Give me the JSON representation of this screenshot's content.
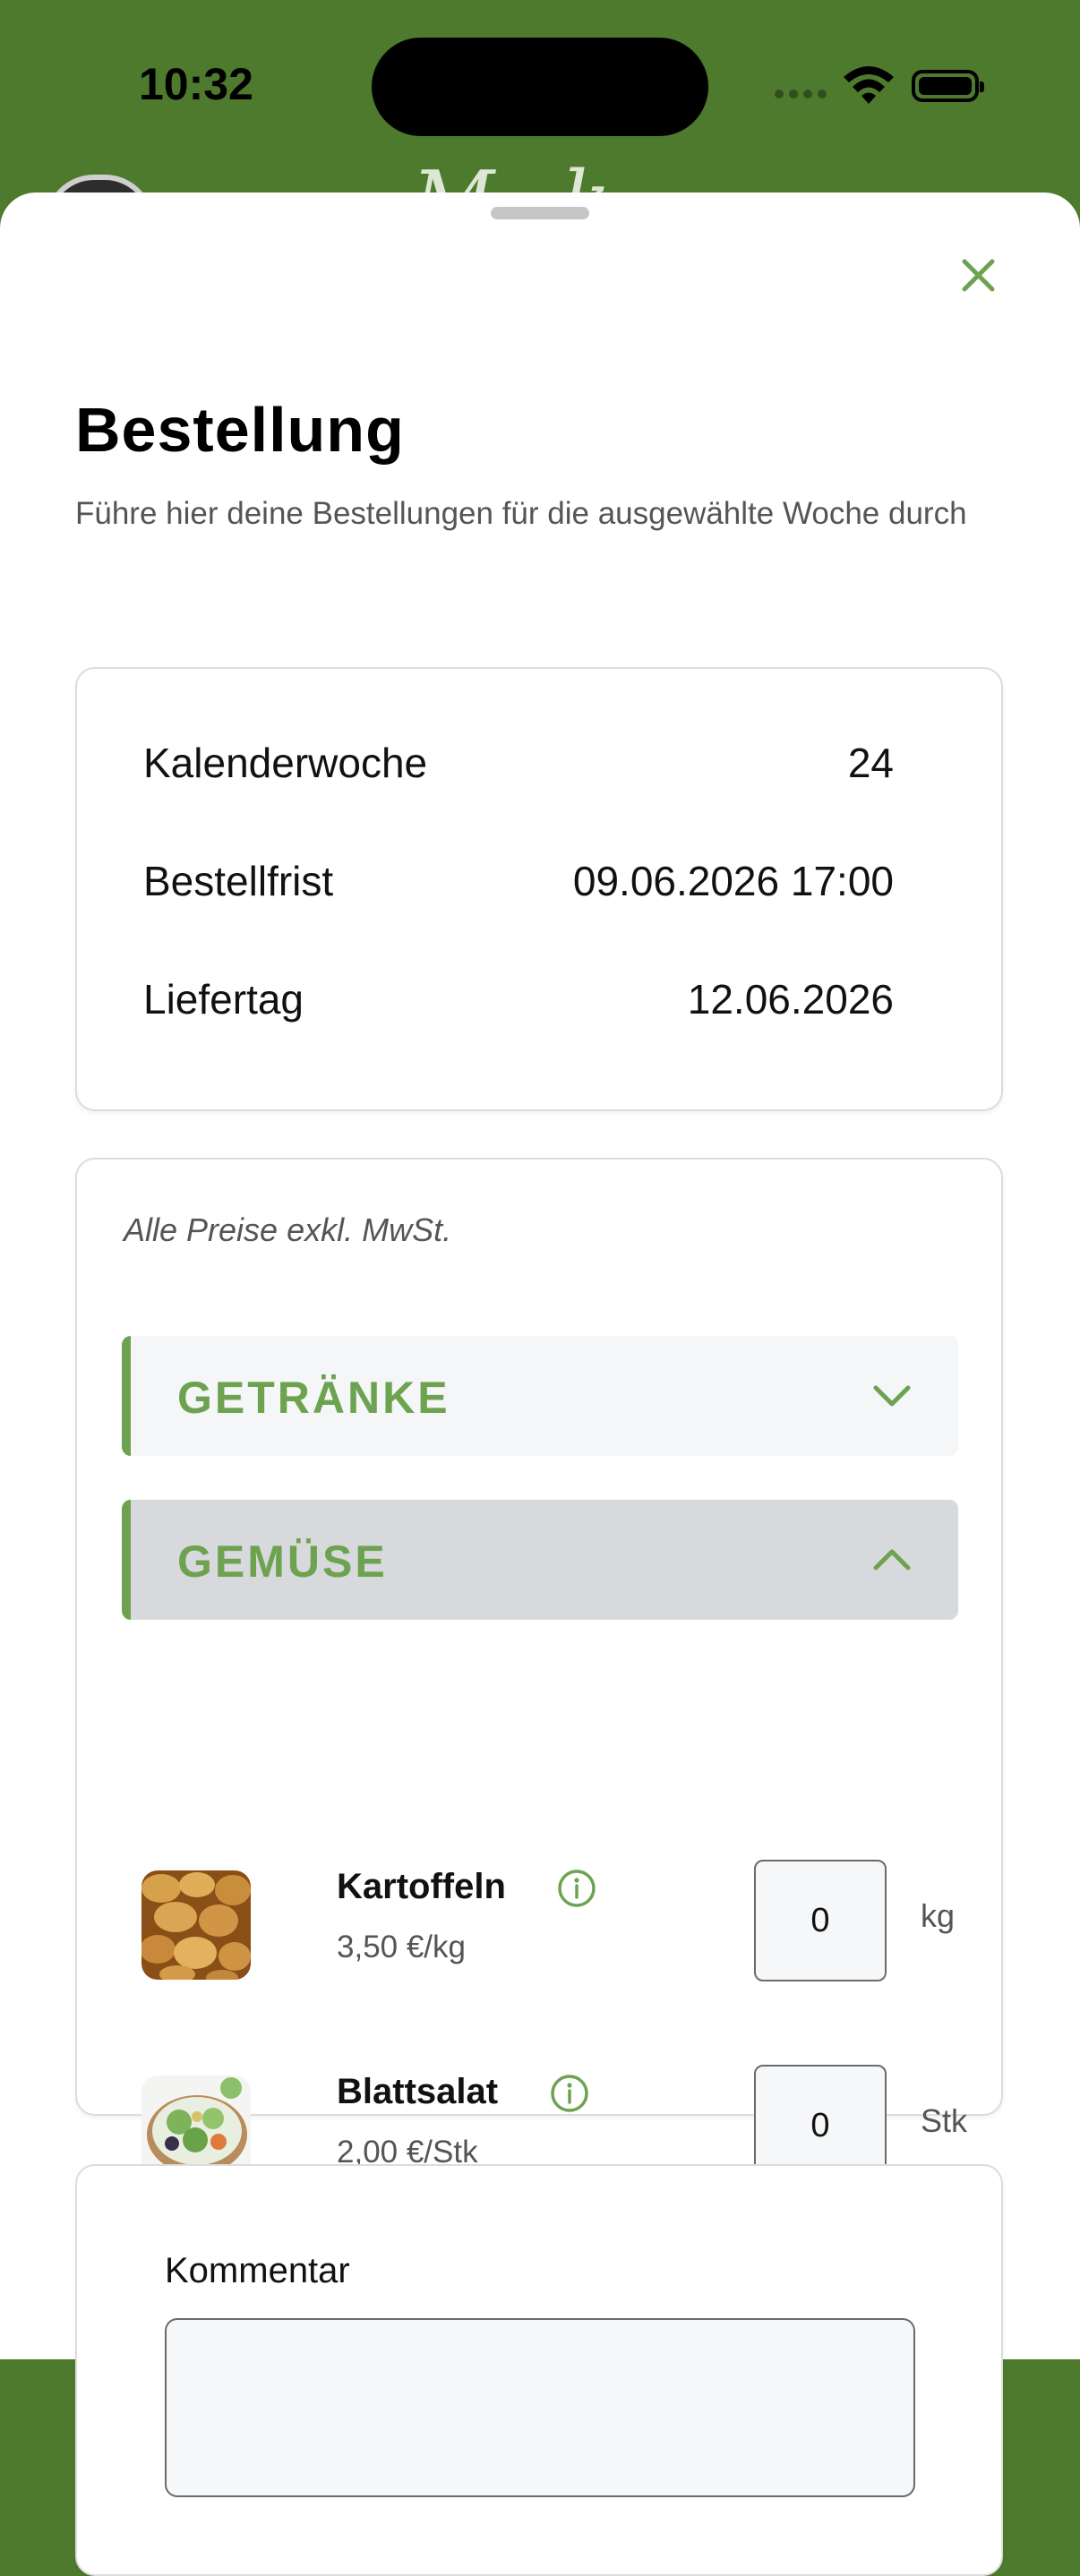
{
  "status_bar": {
    "time": "10:32"
  },
  "sheet": {
    "title": "Bestellung",
    "subtitle": "Führe hier deine Bestellungen für die ausgewählte Woche durch"
  },
  "order_info": {
    "rows": [
      {
        "label": "Kalenderwoche",
        "value": "24"
      },
      {
        "label": "Bestellfrist",
        "value": "09.06.2026 17:00"
      },
      {
        "label": "Liefertag",
        "value": "12.06.2026"
      }
    ]
  },
  "products": {
    "price_note": "Alle Preise exkl. MwSt.",
    "categories": [
      {
        "label": "GETRÄNKE",
        "expanded": false
      },
      {
        "label": "GEMÜSE",
        "expanded": true
      }
    ],
    "items": [
      {
        "name": "Kartoffeln",
        "price": "3,50 €/kg",
        "quantity": "0",
        "unit": "kg",
        "image": "potatoes"
      },
      {
        "name": "Blattsalat",
        "price": "2,00 €/Stk",
        "quantity": "0",
        "unit": "Stk",
        "image": "salad-bowl"
      }
    ]
  },
  "comment": {
    "label": "Kommentar",
    "value": ""
  },
  "colors": {
    "brand_green": "#6da350",
    "header_green": "#4e7a2e",
    "category_active_bg": "#d8d9dc",
    "category_bg": "#f4f6f8"
  }
}
